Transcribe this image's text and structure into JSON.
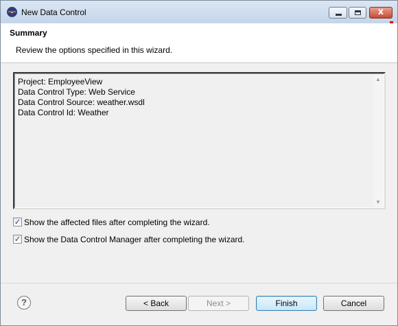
{
  "window": {
    "title": "New Data Control",
    "close_glyph": "x"
  },
  "header": {
    "title": "Summary",
    "description": "Review the options specified in this wizard."
  },
  "summary_lines": [
    "Project: EmployeeView",
    "Data Control Type: Web Service",
    "Data Control Source: weather.wsdl",
    "Data Control Id: Weather"
  ],
  "options": [
    {
      "label": "Show the affected files after completing the wizard.",
      "checked": true
    },
    {
      "label": "Show the Data Control Manager after completing the wizard.",
      "checked": true
    }
  ],
  "footer": {
    "help_glyph": "?",
    "back_label": "< Back",
    "next_label": "Next >",
    "finish_label": "Finish",
    "cancel_label": "Cancel"
  },
  "icons": {
    "app": "eclipse-icon",
    "minimize": "minimize-icon",
    "maximize": "maximize-icon",
    "close": "close-icon",
    "help": "help-icon"
  },
  "colors": {
    "titlebar": "#c4d5ea",
    "close_button": "#c74a33",
    "finish_border": "#3c7fb1",
    "marker": "#e00000"
  }
}
